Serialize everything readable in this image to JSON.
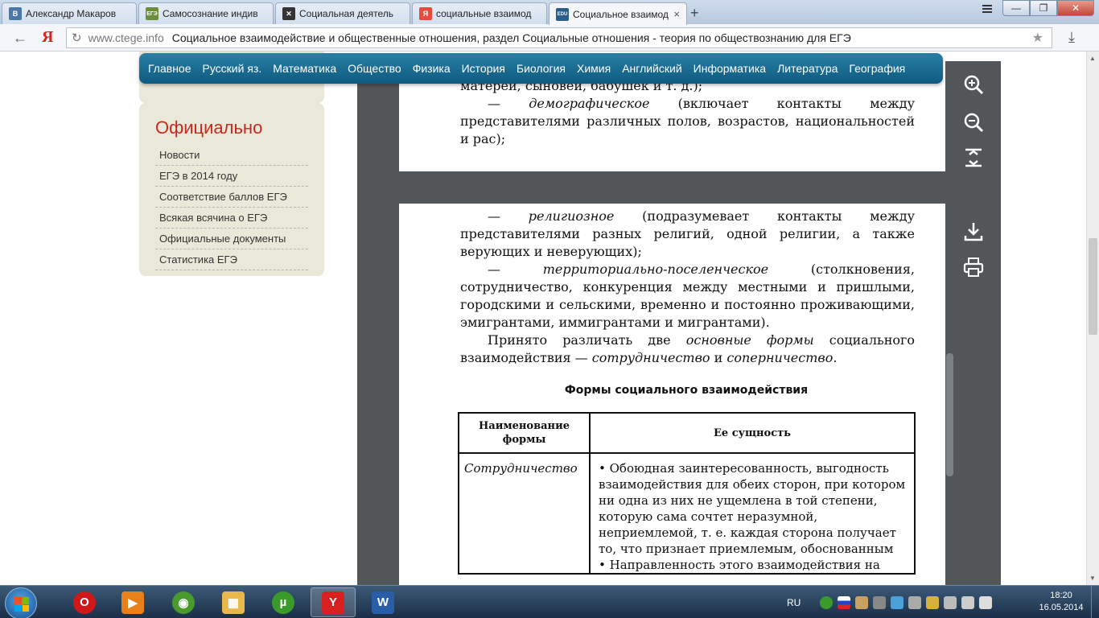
{
  "browser": {
    "tabs": [
      {
        "label": "Александр Макаров",
        "favicon": "vk-icon",
        "favicon_text": "В",
        "color": "#4a76a8",
        "active": false
      },
      {
        "label": "Самосознание индив",
        "favicon": "ege-icon",
        "favicon_text": "ЕГЭ",
        "color": "#6a8f3a",
        "active": false
      },
      {
        "label": "Социальная деятель",
        "favicon": "joomla-icon",
        "favicon_text": "✕",
        "color": "#333333",
        "active": false
      },
      {
        "label": "социальные взаимод",
        "favicon": "yandex-icon",
        "favicon_text": "Я",
        "color": "#e84a3d",
        "active": false
      },
      {
        "label": "Социальное взаимод",
        "favicon": "edu-icon",
        "favicon_text": "EDU",
        "color": "#2a5d8a",
        "active": true
      }
    ],
    "new_tab": "+",
    "window_controls": {
      "minimize": "—",
      "maximize": "❐",
      "close": "✕"
    },
    "address": {
      "domain": "www.ctege.info",
      "title": "Социальное взаимодействие и общественные отношения, раздел Социальные отношения - теория по обществознанию для ЕГЭ"
    }
  },
  "site": {
    "nav": [
      "Главное",
      "Русский яз.",
      "Математика",
      "Общество",
      "Физика",
      "История",
      "Биология",
      "Химия",
      "Английский",
      "Информатика",
      "Литература",
      "География"
    ],
    "sidebar": {
      "title": "Официально",
      "items": [
        "Новости",
        "ЕГЭ в 2014 году",
        "Соответствие баллов ЕГЭ",
        "Всякая всячина о ЕГЭ",
        "Официальные документы",
        "Статистика ЕГЭ"
      ]
    }
  },
  "pdf": {
    "page1": {
      "line1": "матерей, сыновей, бабушек и т. д.);",
      "item_term": "демографическое",
      "item_text": " (включает контакты между представителями различных полов, возрастов, национальностей и рас);"
    },
    "page2": {
      "item1_term": "религиозное",
      "item1_text": " (подразумевает контакты между представителями разных религий, одной религии, а также верующих и неверующих);",
      "item2_term": "территориально-поселенческое",
      "item2_text": " (столкновения, сотрудничество, конкуренция между местными и пришлыми, городскими и сельскими, временно и постоянно проживающими, эмигрантами, иммигрантами и мигрантами).",
      "para_a": "Принято различать две ",
      "para_b": "основные формы",
      "para_c": " социального взаимодействия — ",
      "para_d": "сотрудничество",
      "para_e": " и ",
      "para_f": "соперничество",
      "para_g": ".",
      "caption": "Формы социального взаимодействия",
      "table": {
        "headers": [
          "Наименование формы",
          "Ее сущность"
        ],
        "row_name": "Сотрудничество",
        "bullets": [
          "Обоюдная заинтересованность, выгодность взаимодействия для обеих сторон, при котором ни одна из них не ущемлена в той степени, которую сама сочтет неразумной, неприемлемой, т. е. каждая сторона получает то, что признает приемлемым, обоснованным",
          "Направленность этого взаимодействия на"
        ]
      }
    }
  },
  "taskbar": {
    "apps": [
      {
        "name": "opera",
        "text": "O",
        "color": "#d01818"
      },
      {
        "name": "media-player",
        "text": "▶",
        "color": "#e8801a"
      },
      {
        "name": "games-app",
        "text": "◉",
        "color": "#4a9a2e"
      },
      {
        "name": "explorer",
        "text": "▦",
        "color": "#e8b84a"
      },
      {
        "name": "utorrent",
        "text": "µ",
        "color": "#3a9a2a"
      },
      {
        "name": "yandex-browser",
        "text": "Y",
        "color": "#d82020"
      },
      {
        "name": "word",
        "text": "W",
        "color": "#2a5da8"
      }
    ],
    "lang": "RU",
    "time": "18:20",
    "date": "16.05.2014"
  }
}
